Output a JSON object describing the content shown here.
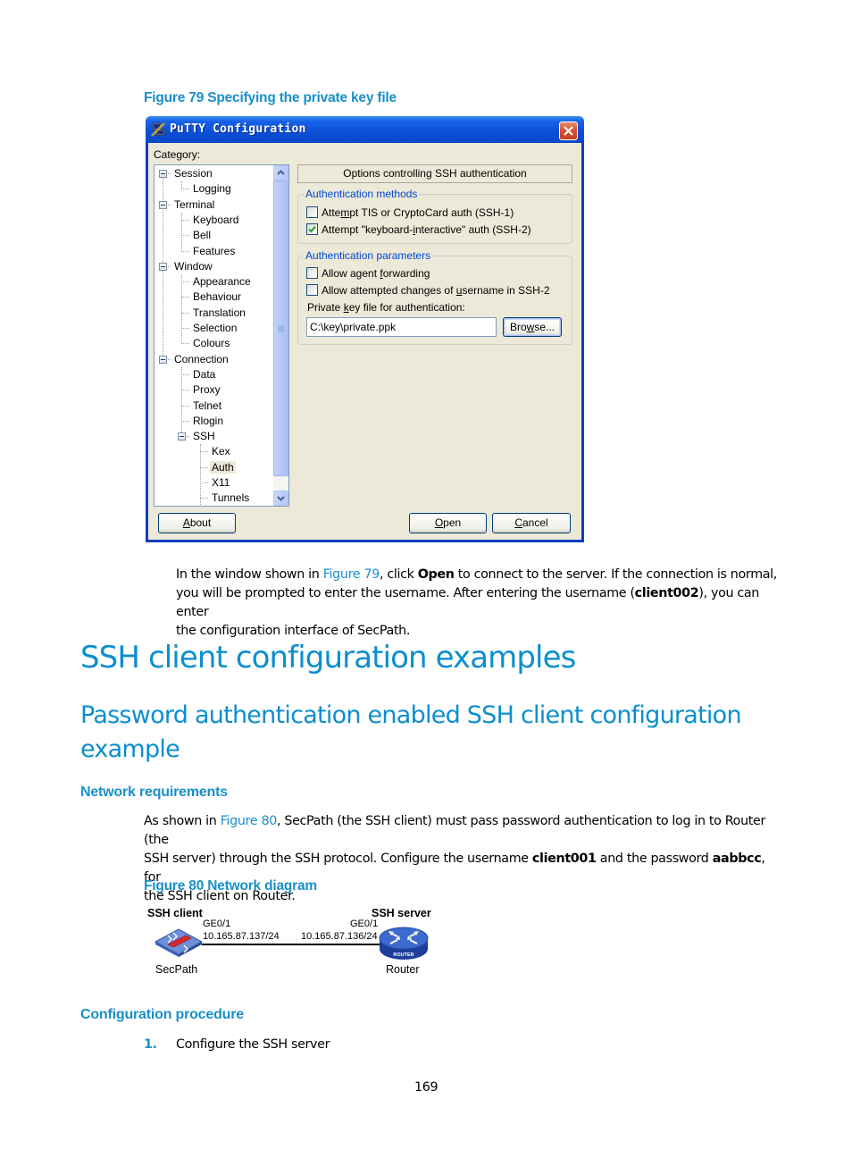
{
  "figure79": {
    "caption": "Figure 79 Specifying the private key file"
  },
  "putty": {
    "title": "PuTTY Configuration",
    "title_icon": "putty-app-icon",
    "close_icon": "close-icon",
    "category_label": "Category:",
    "tree": [
      {
        "label": "Session",
        "level": 0,
        "expanded": true
      },
      {
        "label": "Logging",
        "level": 1
      },
      {
        "label": "Terminal",
        "level": 0,
        "expanded": true
      },
      {
        "label": "Keyboard",
        "level": 1
      },
      {
        "label": "Bell",
        "level": 1
      },
      {
        "label": "Features",
        "level": 1
      },
      {
        "label": "Window",
        "level": 0,
        "expanded": true
      },
      {
        "label": "Appearance",
        "level": 1
      },
      {
        "label": "Behaviour",
        "level": 1
      },
      {
        "label": "Translation",
        "level": 1
      },
      {
        "label": "Selection",
        "level": 1
      },
      {
        "label": "Colours",
        "level": 1
      },
      {
        "label": "Connection",
        "level": 0,
        "expanded": true
      },
      {
        "label": "Data",
        "level": 1
      },
      {
        "label": "Proxy",
        "level": 1
      },
      {
        "label": "Telnet",
        "level": 1
      },
      {
        "label": "Rlogin",
        "level": 1
      },
      {
        "label": "SSH",
        "level": 1,
        "expanded": true
      },
      {
        "label": "Kex",
        "level": 2
      },
      {
        "label": "Auth",
        "level": 2,
        "selected": true
      },
      {
        "label": "X11",
        "level": 2
      },
      {
        "label": "Tunnels",
        "level": 2
      }
    ],
    "panel_title": "Options controlling SSH authentication",
    "auth_methods": {
      "legend": "Authentication methods",
      "options": [
        {
          "label_pre": "Atte",
          "label_ul": "m",
          "label_post": "pt TIS or CryptoCard auth (SSH-1)",
          "checked": false
        },
        {
          "label_pre": "Attempt \"keyboard-",
          "label_ul": "i",
          "label_post": "nteractive\" auth (SSH-2)",
          "checked": true
        }
      ]
    },
    "auth_params": {
      "legend": "Authentication parameters",
      "options": [
        {
          "label_pre": "Allow agent ",
          "label_ul": "f",
          "label_post": "orwarding",
          "checked": false
        },
        {
          "label_pre": "Allow attempted changes of ",
          "label_ul": "u",
          "label_post": "sername in SSH-2",
          "checked": false
        }
      ],
      "key_label_pre": "Private ",
      "key_label_ul": "k",
      "key_label_post": "ey file for authentication:",
      "key_value": "C:\\key\\private.ppk",
      "browse_pre": "Bro",
      "browse_ul": "w",
      "browse_post": "se..."
    },
    "buttons": {
      "about_ul": "A",
      "about_post": "bout",
      "open_ul": "O",
      "open_post": "pen",
      "cancel_ul": "C",
      "cancel_post": "ancel"
    }
  },
  "para1": {
    "t1": "In the window shown in ",
    "link": "Figure 79",
    "t2": ", click ",
    "b1": "Open",
    "t3": " to connect to the server. If the connection is normal,",
    "t4": "you will be prompted to enter the username. After entering the username (",
    "b2": "client002",
    "t5": "), you can enter",
    "t6": "the configuration interface of SecPath."
  },
  "headings": {
    "h1": "SSH client configuration examples",
    "h2_line1": "Password authentication enabled SSH client configuration",
    "h2_line2": "example",
    "h3_network": "Network requirements",
    "h3_config": "Configuration procedure"
  },
  "para2": {
    "t1": "As shown in ",
    "link": "Figure 80",
    "t2": ", SecPath (the SSH client) must pass password authentication to log in to Router (the",
    "t3": "SSH server) through the SSH protocol. Configure the username ",
    "b1": "client001",
    "t4": " and the password ",
    "b2": "aabbcc",
    "t5": ", for",
    "t6": "the SSH client on Router."
  },
  "figure80": {
    "caption": "Figure 80 Network diagram",
    "client_role": "SSH client",
    "server_role": "SSH server",
    "client_iface": "GE0/1",
    "client_ip": "10.165.87.137/24",
    "server_iface": "GE0/1",
    "server_ip": "10.165.87.136/24",
    "client_name": "SecPath",
    "server_name": "Router",
    "router_badge": "ROUTER"
  },
  "steps": [
    {
      "num": "1.",
      "text": "Configure the SSH server"
    }
  ],
  "page_number": "169"
}
